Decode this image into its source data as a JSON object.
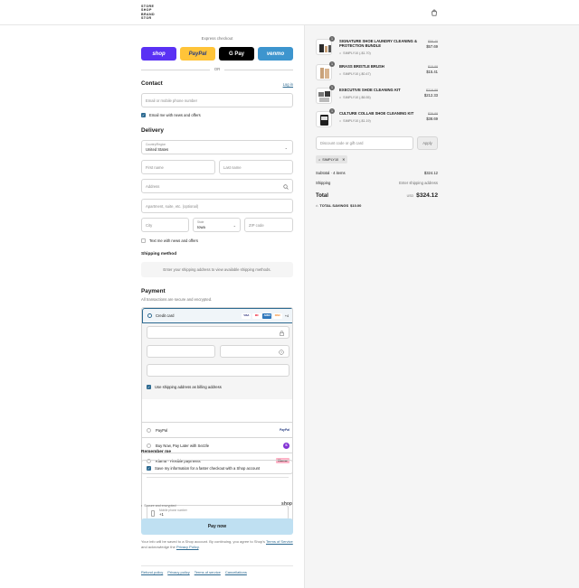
{
  "brand": {
    "logo_lines": [
      "STORE",
      "SHOP",
      "BRAND",
      "STOR"
    ]
  },
  "express": {
    "label": "Express checkout",
    "buttons": [
      {
        "label": "shop",
        "bg": "#5a31f4",
        "fg": "#ffffff"
      },
      {
        "label": "PayPal",
        "bg": "#ffc439",
        "fg": "#253b80"
      },
      {
        "label": "G Pay",
        "bg": "#000000",
        "fg": "#ffffff"
      },
      {
        "label": "venmo",
        "bg": "#3d95ce",
        "fg": "#ffffff"
      }
    ],
    "or": "OR"
  },
  "contact": {
    "title": "Contact",
    "login_link": "Log in",
    "email_placeholder": "Email or mobile phone number",
    "newsletter_label": "Email me with news and offers"
  },
  "delivery": {
    "title": "Delivery",
    "country_label": "Country/Region",
    "country_value": "United States",
    "first_name": "First name",
    "last_name": "Last name",
    "address": "Address",
    "apartment": "Apartment, suite, etc. (optional)",
    "city": "City",
    "state_label": "State",
    "state_value": "Iowa",
    "zip": "ZIP code",
    "text_offers": "Text me with news and offers"
  },
  "shipping": {
    "title": "Shipping method",
    "notice": "Enter your shipping address to view available shipping methods."
  },
  "payment": {
    "title": "Payment",
    "subtitle": "All transactions are secure and encrypted.",
    "credit_card": "Credit card",
    "card_badges": [
      "VISA",
      "MC",
      "AMEX",
      "DISC"
    ],
    "more_cards": "+4",
    "billing_same": "Use shipping address as billing address",
    "methods": [
      {
        "label": "PayPal",
        "logo": "PayPal"
      },
      {
        "label": "Buy Now, Pay Later with Sezzle",
        "logo": "S"
      },
      {
        "label": "Klarna - Flexible payments",
        "logo": "Klarna."
      }
    ]
  },
  "remember": {
    "title": "Remember me",
    "save_label": "Save my information for a faster checkout with a Shop account",
    "phone_label": "Mobile phone number",
    "phone_value": "+1",
    "secure": "Secure and encrypted",
    "shop_logo": "shop"
  },
  "pay_now": "Pay now",
  "legal": {
    "text1": "Your info will be saved to a Shop account. By continuing, you agree to Shop's",
    "terms": "Terms of Service",
    "text2": "and acknowledge the",
    "privacy": "Privacy Policy",
    "end": "."
  },
  "footer_links": [
    "Refund policy",
    "Privacy policy",
    "Terms of service",
    "Cancellations"
  ],
  "cart": {
    "items": [
      {
        "name": "SIGNATURE SHOE LAUNDRY CLEANING & PROTECTION BUNDLE",
        "qty": "1",
        "discount": "SIMPLY10 (-$1.70)",
        "old_price": "$59.40",
        "price": "$57.69"
      },
      {
        "name": "BRASS BRISTLE BRUSH",
        "qty": "1",
        "discount": "SIMPLY10 (-$0.47)",
        "old_price": "$15.88",
        "price": "$15.41"
      },
      {
        "name": "EXECUTIVE SHOE CLEANING KIT",
        "qty": "1",
        "discount": "SIMPLY10 (-$6.55)",
        "old_price": "$219.88",
        "price": "$212.33"
      },
      {
        "name": "CULTURE COLLAB SHOE CLEANING KIT",
        "qty": "1",
        "discount": "SIMPLY10 (-$1.19)",
        "old_price": "$39.88",
        "price": "$38.69"
      }
    ],
    "discount_placeholder": "Discount code or gift card",
    "apply": "Apply",
    "applied_code": "SIMPLY10",
    "subtotal_label": "Subtotal · 4 items",
    "subtotal": "$324.12",
    "shipping_label": "Shipping",
    "shipping_value": "Enter shipping address",
    "total_label": "Total",
    "currency": "USD",
    "total": "$324.12",
    "savings_label": "TOTAL SAVINGS",
    "savings": "$10.00"
  }
}
